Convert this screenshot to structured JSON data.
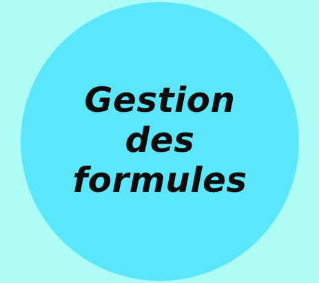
{
  "colors": {
    "background": "#aefcf6",
    "circle": "#5ce6fb",
    "text": "#0c0c0c"
  },
  "badge": {
    "lines": [
      "Gestion",
      "des",
      "formules"
    ]
  }
}
